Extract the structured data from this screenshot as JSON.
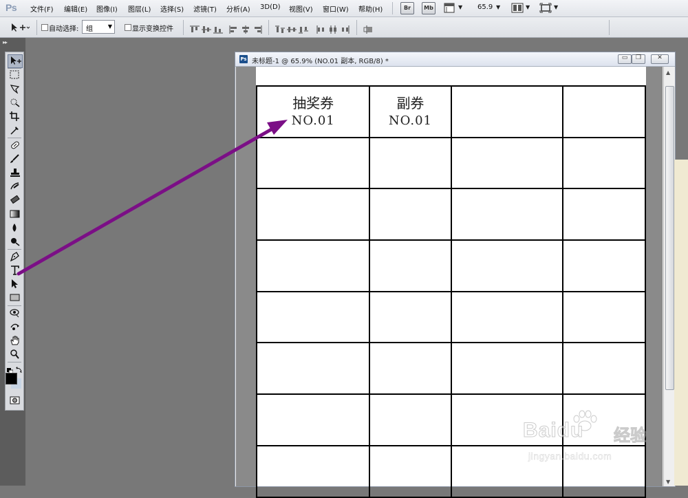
{
  "app": {
    "logo": "Ps",
    "menu": [
      "文件(F)",
      "编辑(E)",
      "图像(I)",
      "图层(L)",
      "选择(S)",
      "滤镜(T)",
      "分析(A)",
      "3D(D)",
      "视图(V)",
      "窗口(W)",
      "帮助(H)"
    ],
    "bridge_label": "Br",
    "minibridge_label": "Mb",
    "zoom_value": "65.9"
  },
  "options": {
    "auto_select_label": "自动选择:",
    "auto_select_value": "组",
    "show_transform_label": "显示变换控件"
  },
  "document": {
    "title": "未标题-1 @ 65.9% (NO.01 副本, RGB/8) *",
    "ps_badge": "Ps",
    "minimize": "▭",
    "restore": "❐",
    "close": "✕",
    "table": {
      "main_title": "抽奖券",
      "main_no": "NO.01",
      "stub_title": "副券",
      "stub_no": "NO.01"
    }
  },
  "colors": {
    "arrow": "#7b0f86",
    "foreground": "#000000",
    "background": "#c7d4e4"
  },
  "watermark": {
    "brand": "Baidu",
    "brand_cn": "经验",
    "domain": "jingyan.baidu.com"
  }
}
